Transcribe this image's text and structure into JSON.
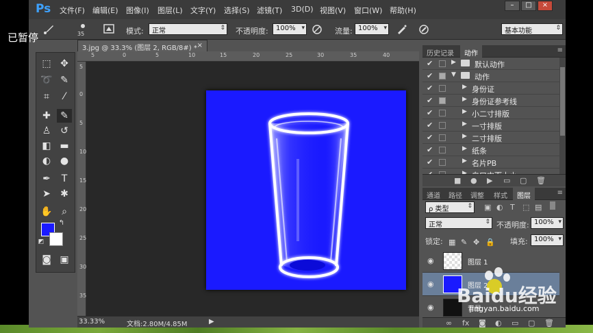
{
  "overlay": {
    "paused_label": "已暂停"
  },
  "menubar": {
    "logo": "Ps",
    "items": [
      "文件(F)",
      "编辑(E)",
      "图像(I)",
      "图层(L)",
      "文字(Y)",
      "选择(S)",
      "滤镜(T)",
      "3D(D)",
      "视图(V)",
      "窗口(W)",
      "帮助(H)"
    ],
    "window_buttons": [
      "–",
      "□",
      "×"
    ]
  },
  "options": {
    "brush_size": "35",
    "mode_label": "模式:",
    "mode_value": "正常",
    "opacity_label": "不透明度:",
    "opacity_value": "100%",
    "flow_label": "流量:",
    "flow_value": "100%",
    "workspace_value": "基本功能"
  },
  "document": {
    "tab_title": "3.jpg @ 33.3% (图层 2, RGB/8#) *",
    "tab_close": "×",
    "ruler_top_ticks": [
      "5",
      "0",
      "5",
      "10",
      "15",
      "20",
      "25",
      "30",
      "35",
      "40"
    ],
    "ruler_left_ticks": [
      "5",
      "0",
      "5",
      "10",
      "15",
      "20",
      "25",
      "30",
      "35"
    ],
    "canvas_color": "#1a1aff",
    "status": {
      "zoom": "33.33%",
      "doc_info": "文档:2.80M/4.85M",
      "arrow": "▶"
    }
  },
  "panels": {
    "top_tabs": [
      "历史记录",
      "动作"
    ],
    "actions": [
      {
        "label": "默认动作",
        "level": 0,
        "type": "folder",
        "has_box": false
      },
      {
        "label": "动作",
        "level": 0,
        "type": "folder-open",
        "has_box": true
      },
      {
        "label": "身份证",
        "level": 1,
        "type": "action",
        "has_box": false
      },
      {
        "label": "身份证参考线",
        "level": 1,
        "type": "action",
        "has_box": true
      },
      {
        "label": "小二寸排版",
        "level": 1,
        "type": "action",
        "has_box": false
      },
      {
        "label": "一寸排版",
        "level": 1,
        "type": "action",
        "has_box": false
      },
      {
        "label": "二寸排版",
        "level": 1,
        "type": "action",
        "has_box": false
      },
      {
        "label": "纸条",
        "level": 1,
        "type": "action",
        "has_box": false
      },
      {
        "label": "名片PB",
        "level": 1,
        "type": "action",
        "has_box": false
      },
      {
        "label": "白口中而十小",
        "level": 1,
        "type": "action",
        "has_box": false
      }
    ],
    "layer_tabs": [
      "通道",
      "路径",
      "调整",
      "样式",
      "图层"
    ],
    "layers": {
      "filter_kind": "ρ 类型",
      "blend_mode": "正常",
      "opacity_label": "不透明度:",
      "opacity_value": "100%",
      "lock_label": "锁定:",
      "fill_label": "填充:",
      "fill_value": "100%",
      "items": [
        {
          "name": "图层 1",
          "thumb": "transparent"
        },
        {
          "name": "图层 2",
          "thumb": "blue"
        },
        {
          "name": "背景",
          "thumb": "black"
        }
      ]
    }
  },
  "watermark": {
    "brand": "Baidu经验",
    "url": "jingyan.baidu.com"
  }
}
